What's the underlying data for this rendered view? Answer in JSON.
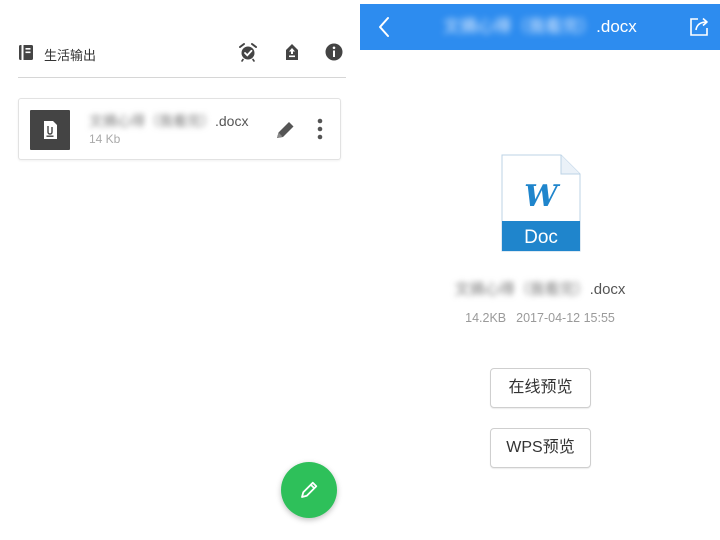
{
  "left": {
    "header": {
      "title": "生活输出",
      "icons": [
        "book-icon",
        "alarm-icon",
        "upload-icon",
        "info-icon"
      ]
    },
    "file": {
      "name_blurred": "文摘心得（我看完）",
      "name_ext": ".docx",
      "size": "14 Kb",
      "icons": [
        "file-thumbnail-icon",
        "edit-pencil-icon",
        "more-vertical-icon"
      ]
    },
    "fab": {
      "icon": "pencil-icon",
      "color": "#2ec05a"
    }
  },
  "right": {
    "topbar": {
      "title_blurred": "文摘心得（我看完）",
      "title_ext": ".docx",
      "color": "#2d8cef",
      "icons": [
        "back-chevron-icon",
        "share-icon"
      ]
    },
    "doc": {
      "badge_letter": "W",
      "badge_label": "Doc",
      "name_blurred": "文摘心得（我看完）",
      "name_ext": ".docx",
      "size": "14.2KB",
      "date": "2017-04-12 15:55"
    },
    "buttons": {
      "online_preview": "在线预览",
      "wps_preview": "WPS预览"
    }
  }
}
